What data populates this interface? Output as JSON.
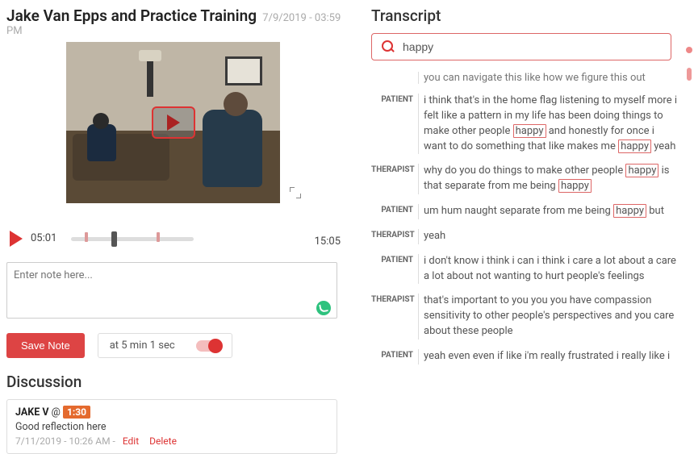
{
  "header": {
    "title": "Jake Van Epps and Practice Training",
    "timestamp": "7/9/2019 - 03:59 PM"
  },
  "video": {
    "current_time": "05:01",
    "total_time": "15:05",
    "marker1_pct": 11,
    "thumb_pct": 33,
    "marker2_pct": 70
  },
  "notes": {
    "placeholder": "Enter note here...",
    "save_label": "Save Note",
    "at_label": "at  5 min 1 sec"
  },
  "discussion": {
    "heading": "Discussion",
    "comment": {
      "author": "JAKE V",
      "at_symbol": "@",
      "time_badge": "1:30",
      "body": "Good reflection here",
      "meta_ts": "7/11/2019 - 10:26 AM",
      "edit_label": "Edit",
      "delete_label": "Delete"
    }
  },
  "transcript": {
    "heading": "Transcript",
    "search_value": "happy",
    "partial_top": "you can navigate this like how we figure this out",
    "rows": [
      {
        "speaker": "PATIENT",
        "text": "i think that's in the home flag listening to myself more i felt like a pattern in my life has been doing things to make other people {happy} and honestly for once i want to do something that like makes me {happy} yeah"
      },
      {
        "speaker": "THERAPIST",
        "text": "why do you do things to make other people {happy} is that separate from me being {happy}"
      },
      {
        "speaker": "PATIENT",
        "text": "um hum naught separate from me being {happy} but"
      },
      {
        "speaker": "THERAPIST",
        "text": "yeah"
      },
      {
        "speaker": "PATIENT",
        "text": "i don't know i think i can i think i care a lot about a care a lot about not wanting to hurt people's feelings"
      },
      {
        "speaker": "THERAPIST",
        "text": "that's important to you you you have compassion sensitivity to other people's perspectives and you care about these people"
      },
      {
        "speaker": "PATIENT",
        "text": "yeah even even if like i'm really frustrated i really like i"
      }
    ]
  }
}
